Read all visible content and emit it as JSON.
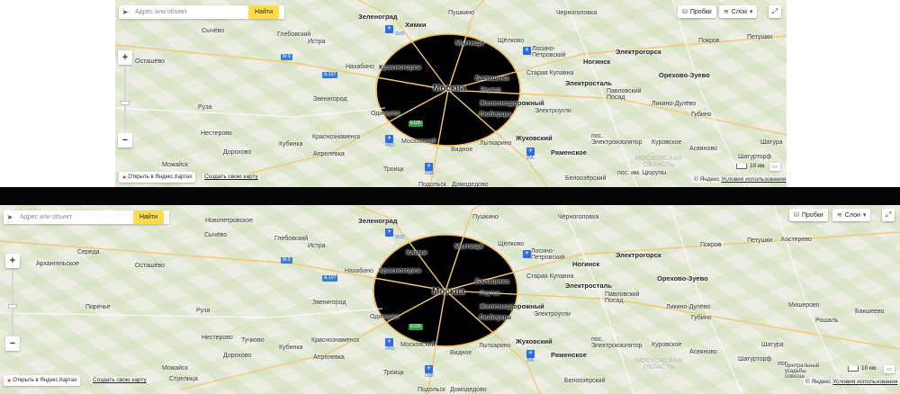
{
  "controls": {
    "search_placeholder": "Адрес или объект",
    "find_label": "Найти",
    "traffic_label": "Пробки",
    "layers_label": "Слои",
    "zoom_in": "+",
    "zoom_out": "−",
    "open_in_yandex_maps": "Открыть в Яндекс.Картах",
    "create_own_map": "Создать свою карту",
    "scale_label": "10 км",
    "copyright_yandex": "© Яндекс",
    "terms_link": "Условия использования"
  },
  "icons": {
    "locate": "locate-arrow-icon",
    "traffic": "traffic-icon",
    "layers": "layers-icon",
    "fullscreen": "fullscreen-icon",
    "pin": "map-pin-icon",
    "ruler": "ruler-icon"
  },
  "colors": {
    "find_button": "#ffdb4d",
    "metro_icon": "#2e6be0",
    "roads": "#f1c877",
    "pin": "#e33333"
  },
  "map_top": {
    "labels": {
      "moscow": "Москва",
      "zelenograd": "Зеленоград",
      "pushkino": "Пушкино",
      "chernogolovka": "Черноголовка",
      "khimki": "Химки",
      "mytishchi": "Мытищи",
      "shchelkovo": "Щёлково",
      "losino": "Лосино-\nПетровский",
      "elektrogorsk": "Электрогорск",
      "pokrov": "Покров",
      "petushki": "Петушки",
      "solnechnogorsk": "Сычёво",
      "glebovsky": "Глебовский",
      "istra": "Истра",
      "ostashevo": "Осташёво",
      "nakhabino": "Нахабино",
      "krasnogorsk": "Красногорск",
      "balashikha": "Балашиха",
      "staraya_kupavna": "Старая Купавна",
      "noginsk": "Ногинск",
      "orekhovo": "Орехово-Зуево",
      "elektrostal": "Электросталь",
      "zvenigorod": "Звенигород",
      "reutov": "Реутов",
      "zheleznodorozhny": "Железнодорожный",
      "pavlovsky_posad": "Павловский\nПосад",
      "likino": "Ликино-Дулёво",
      "ruza": "Руза",
      "odintsovo": "Одинцово",
      "lyubertsy": "Люберцы",
      "elektrougli": "Электроугли",
      "gubino": "Губино",
      "nesterovo": "Нестерово",
      "krasnoznamensk": "Краснознаменск",
      "moskovsky": "Московский",
      "lytkarino": "Лыткарино",
      "zhukovsky": "Жуковский",
      "elektroizolyator": "пос.\nЭлектроизолятор",
      "kurovskoe": "Куровское",
      "shatura": "Шатура",
      "dorokhovo": "Дорохово",
      "kubinka": "Кубинка",
      "aprelevka": "Апрелевка",
      "vidnoe": "Видное",
      "ramenskoe": "Раменское",
      "asvanovo": "Асвяново",
      "shaturtorf": "Шатурторф",
      "mozhaysk": "Можайск",
      "troitsk": "Троицк",
      "belooziorsky": "Белоозёрский",
      "moscow_oblast": "МОСКОВСКАЯ\nОБЛАСТЬ",
      "tsyurupy": "пос. им. Цюрупы",
      "podolsk": "Подольск",
      "domodedovo": "Домодедово",
      "svo": "SVO",
      "vko": "VKO",
      "dme": "DME",
      "osf": "OSF",
      "zia": "ZIA"
    }
  },
  "map_bottom": {
    "labels": {
      "novopetrovskoe": "Новопетровское",
      "arkhangelskoe": "Архангельское",
      "sereda": "Середа",
      "porechye": "Поречье",
      "kosterevo": "Костерево",
      "mishcherovo": "Мишерово",
      "roshal": "Рошаль",
      "bashkino": "Бакшеево",
      "tuchkovo": "Тучково",
      "strelitsa": "Стрелица",
      "tsentralny": "Центральный\nусадьбы\nсовхоза",
      "egoryevsk": "пос."
    }
  }
}
